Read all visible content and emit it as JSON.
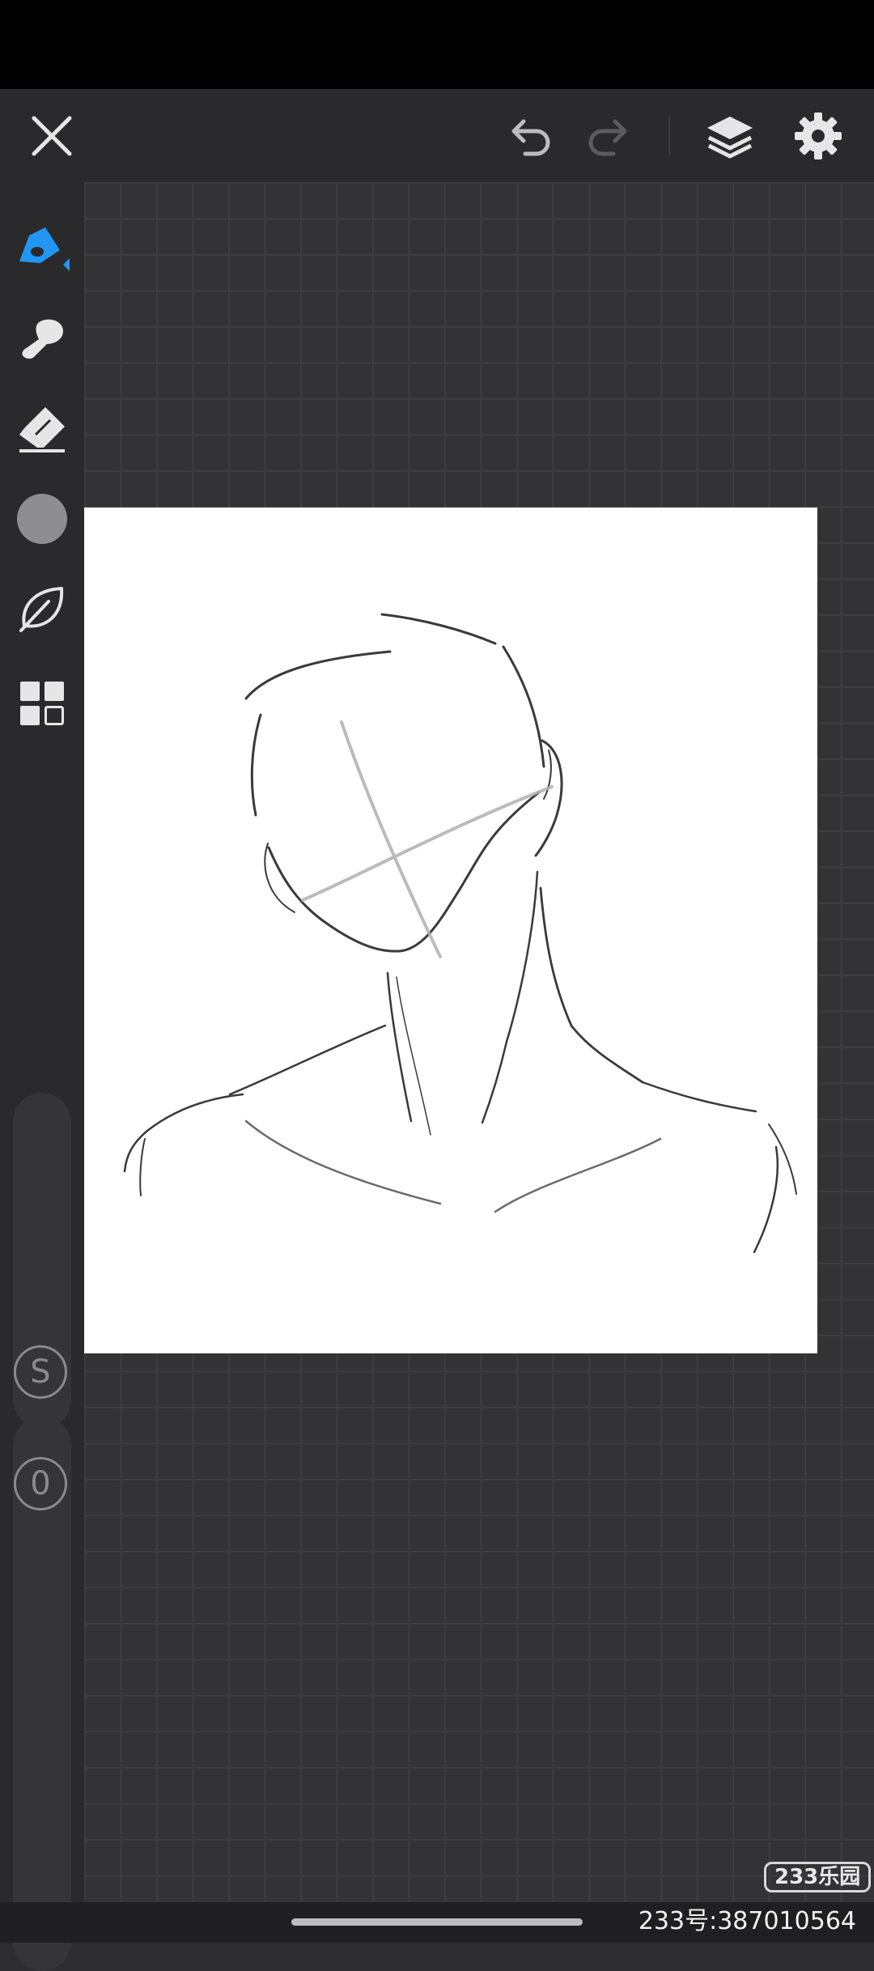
{
  "toolbar": {
    "close": "close-icon",
    "undo": "undo-icon",
    "redo": "redo-icon",
    "layers": "layers-icon",
    "settings": "gear-icon"
  },
  "tools": [
    {
      "name": "pen-tool",
      "icon": "pen-icon",
      "active": true
    },
    {
      "name": "smudge-tool",
      "icon": "smudge-icon"
    },
    {
      "name": "eraser-tool",
      "icon": "eraser-icon"
    },
    {
      "name": "color-picker",
      "icon": "color-swatch",
      "color": "#8e8e90"
    },
    {
      "name": "brush-library",
      "icon": "leaf-icon"
    },
    {
      "name": "gallery",
      "icon": "grid-icon"
    }
  ],
  "sliders": {
    "size_label": "S",
    "opacity_label": "0"
  },
  "watermark": {
    "logo": "233乐园",
    "id": "233号:387010564"
  },
  "colors": {
    "accent": "#2196f3",
    "background": "#2d2d2f",
    "paper": "#ffffff"
  }
}
